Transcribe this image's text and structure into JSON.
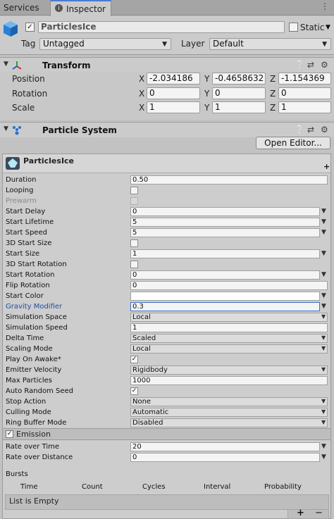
{
  "tabs": {
    "services": "Services",
    "inspector": "Inspector"
  },
  "object": {
    "name": "ParticlesIce",
    "static_label": "Static",
    "tag_label": "Tag",
    "tag_value": "Untagged",
    "layer_label": "Layer",
    "layer_value": "Default"
  },
  "transform": {
    "title": "Transform",
    "position": {
      "label": "Position",
      "x": "-2.034186",
      "y": "-0.4658632",
      "z": "-1.154369"
    },
    "rotation": {
      "label": "Rotation",
      "x": "0",
      "y": "0",
      "z": "0"
    },
    "scale": {
      "label": "Scale",
      "x": "1",
      "y": "1",
      "z": "1"
    },
    "axis": {
      "x": "X",
      "y": "Y",
      "z": "Z"
    }
  },
  "particle_system": {
    "title": "Particle System",
    "open_editor": "Open Editor...",
    "module_name": "ParticlesIce"
  },
  "main_props": [
    {
      "label": "Duration",
      "value": "0.50",
      "kind": "field"
    },
    {
      "label": "Looping",
      "value": "",
      "kind": "check"
    },
    {
      "label": "Prewarm",
      "value": "",
      "kind": "check-disabled"
    },
    {
      "label": "Start Delay",
      "value": "0",
      "kind": "field-arrow"
    },
    {
      "label": "Start Lifetime",
      "value": "5",
      "kind": "field-arrow"
    },
    {
      "label": "Start Speed",
      "value": "5",
      "kind": "field-arrow"
    },
    {
      "label": "3D Start Size",
      "value": "",
      "kind": "check"
    },
    {
      "label": "Start Size",
      "value": "1",
      "kind": "field-arrow"
    },
    {
      "label": "3D Start Rotation",
      "value": "",
      "kind": "check"
    },
    {
      "label": "Start Rotation",
      "value": "0",
      "kind": "field-arrow"
    },
    {
      "label": "Flip Rotation",
      "value": "0",
      "kind": "field"
    },
    {
      "label": "Start Color",
      "value": "",
      "kind": "color-arrow"
    },
    {
      "label": "Gravity Modifier",
      "value": "0.3",
      "kind": "field-arrow-active"
    },
    {
      "label": "Simulation Space",
      "value": "Local",
      "kind": "dropdown"
    },
    {
      "label": "Simulation Speed",
      "value": "1",
      "kind": "field"
    },
    {
      "label": "Delta Time",
      "value": "Scaled",
      "kind": "dropdown"
    },
    {
      "label": "Scaling Mode",
      "value": "Local",
      "kind": "dropdown"
    },
    {
      "label": "Play On Awake*",
      "value": "✓",
      "kind": "check"
    },
    {
      "label": "Emitter Velocity",
      "value": "Rigidbody",
      "kind": "dropdown"
    },
    {
      "label": "Max Particles",
      "value": "1000",
      "kind": "field"
    },
    {
      "label": "Auto Random Seed",
      "value": "✓",
      "kind": "check"
    },
    {
      "label": "Stop Action",
      "value": "None",
      "kind": "dropdown"
    },
    {
      "label": "Culling Mode",
      "value": "Automatic",
      "kind": "dropdown"
    },
    {
      "label": "Ring Buffer Mode",
      "value": "Disabled",
      "kind": "dropdown"
    }
  ],
  "emission": {
    "title": "Emission",
    "rate_time_label": "Rate over Time",
    "rate_time": "20",
    "rate_dist_label": "Rate over Distance",
    "rate_dist": "0",
    "bursts_label": "Bursts",
    "columns": [
      "Time",
      "Count",
      "Cycles",
      "Interval",
      "Probability"
    ],
    "empty": "List is Empty",
    "add": "+",
    "remove": "−"
  }
}
